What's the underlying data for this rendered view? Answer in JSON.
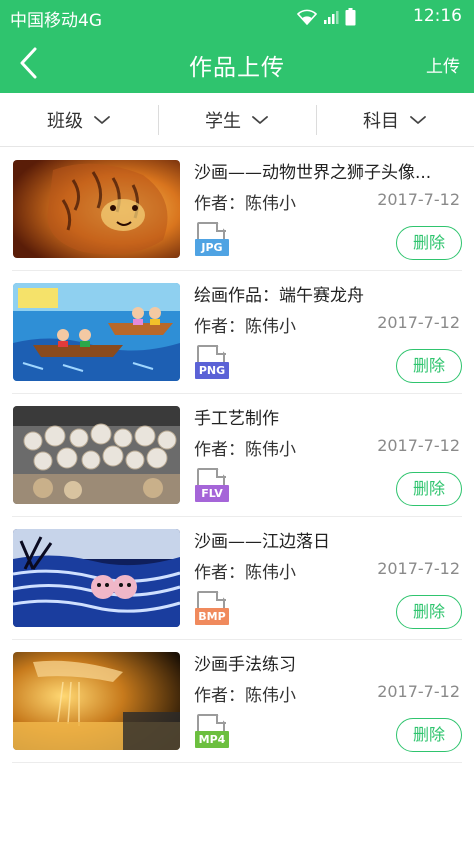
{
  "status_bar": {
    "carrier": "中国移动4G",
    "time": "12:16"
  },
  "nav": {
    "title": "作品上传",
    "action_label": "上传"
  },
  "filters": [
    {
      "label": "班级"
    },
    {
      "label": "学生"
    },
    {
      "label": "科目"
    }
  ],
  "works": [
    {
      "title": "沙画——动物世界之狮子头像...",
      "author": "作者：陈伟小",
      "date": "2017-7-12",
      "file_type": "JPG",
      "file_color": "#4fa3e3",
      "delete_label": "删除",
      "thumbnail": "lion-sand-painting"
    },
    {
      "title": "绘画作品：端午赛龙舟",
      "author": "作者：陈伟小",
      "date": "2017-7-12",
      "file_type": "PNG",
      "file_color": "#5b62d6",
      "delete_label": "删除",
      "thumbnail": "dragon-boat-drawing"
    },
    {
      "title": "手工艺制作",
      "author": "作者：陈伟小",
      "date": "2017-7-12",
      "file_type": "FLV",
      "file_color": "#a565d8",
      "delete_label": "删除",
      "thumbnail": "handicraft-plates"
    },
    {
      "title": "沙画——江边落日",
      "author": "作者：陈伟小",
      "date": "2017-7-12",
      "file_type": "BMP",
      "file_color": "#f08a5d",
      "delete_label": "删除",
      "thumbnail": "riverside-sunset"
    },
    {
      "title": "沙画手法练习",
      "author": "作者：陈伟小",
      "date": "2017-7-12",
      "file_type": "MP4",
      "file_color": "#6cbf3f",
      "delete_label": "删除",
      "thumbnail": "sand-practice"
    }
  ]
}
